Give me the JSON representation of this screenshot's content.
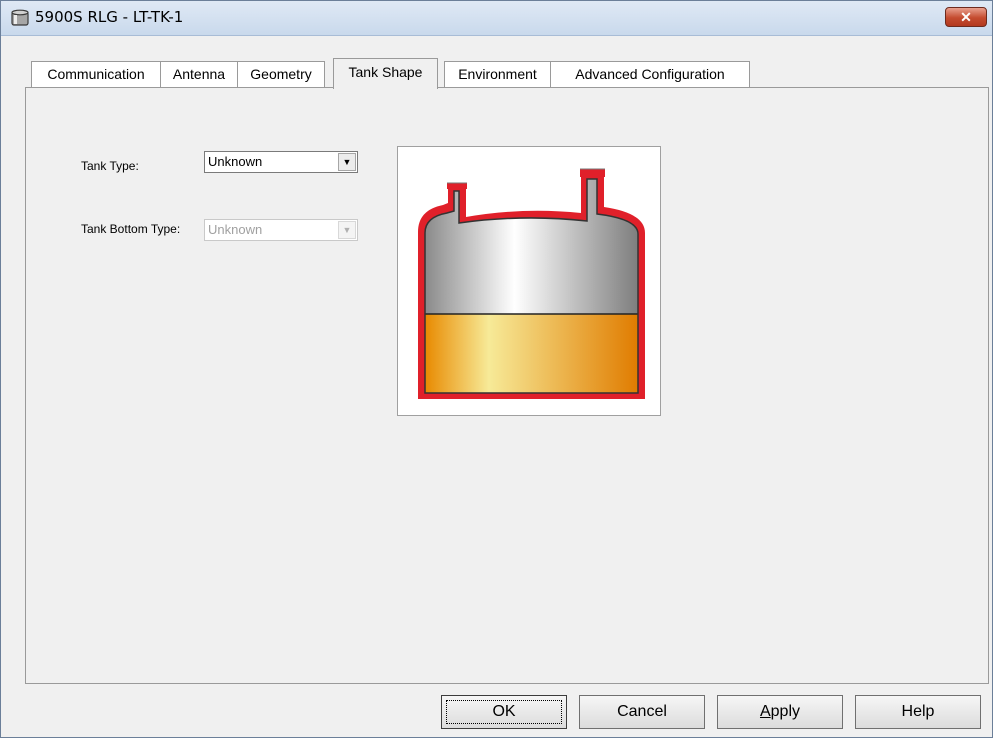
{
  "window": {
    "title": "5900S RLG  - LT-TK-1",
    "icon": "tank-cylinder-icon",
    "close_glyph": "✕"
  },
  "tabs": [
    {
      "label": "Communication",
      "active": false
    },
    {
      "label": "Antenna",
      "active": false
    },
    {
      "label": "Geometry",
      "active": false
    },
    {
      "label": "Tank Shape",
      "active": true
    },
    {
      "label": "Environment",
      "active": false
    },
    {
      "label": "Advanced Configuration",
      "active": false
    }
  ],
  "form": {
    "tank_type_label": "Tank Type:",
    "tank_type_value": "Unknown",
    "tank_bottom_type_label": "Tank Bottom Type:",
    "tank_bottom_type_value": "Unknown",
    "tank_bottom_type_enabled": false
  },
  "illustration": {
    "name": "tank-illustration",
    "colors": {
      "shell": "#e0202a",
      "liquid": "#e88a00",
      "liquid_highlight": "#f7ea98",
      "vapor_dark": "#8a8a8a",
      "vapor_light": "#ffffff"
    }
  },
  "buttons": {
    "ok": "OK",
    "cancel": "Cancel",
    "apply_first": "A",
    "apply_rest": "pply",
    "help": "Help"
  }
}
